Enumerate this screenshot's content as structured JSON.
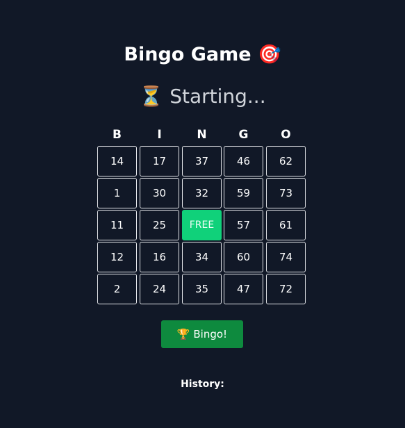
{
  "header": {
    "title": "Bingo Game",
    "title_icon": "🎯",
    "status_icon": "⏳",
    "status_text": "Starting..."
  },
  "card": {
    "letters": [
      "B",
      "I",
      "N",
      "G",
      "O"
    ],
    "rows": [
      [
        "14",
        "17",
        "37",
        "46",
        "62"
      ],
      [
        "1",
        "30",
        "32",
        "59",
        "73"
      ],
      [
        "11",
        "25",
        "FREE",
        "57",
        "61"
      ],
      [
        "12",
        "16",
        "34",
        "60",
        "74"
      ],
      [
        "2",
        "24",
        "35",
        "47",
        "72"
      ]
    ]
  },
  "actions": {
    "bingo_icon": "🏆",
    "bingo_label": "Bingo!"
  },
  "history": {
    "label": "History:"
  },
  "colors": {
    "background": "#111827",
    "free_cell": "#10d17a",
    "bingo_button": "#0e8a3e"
  }
}
